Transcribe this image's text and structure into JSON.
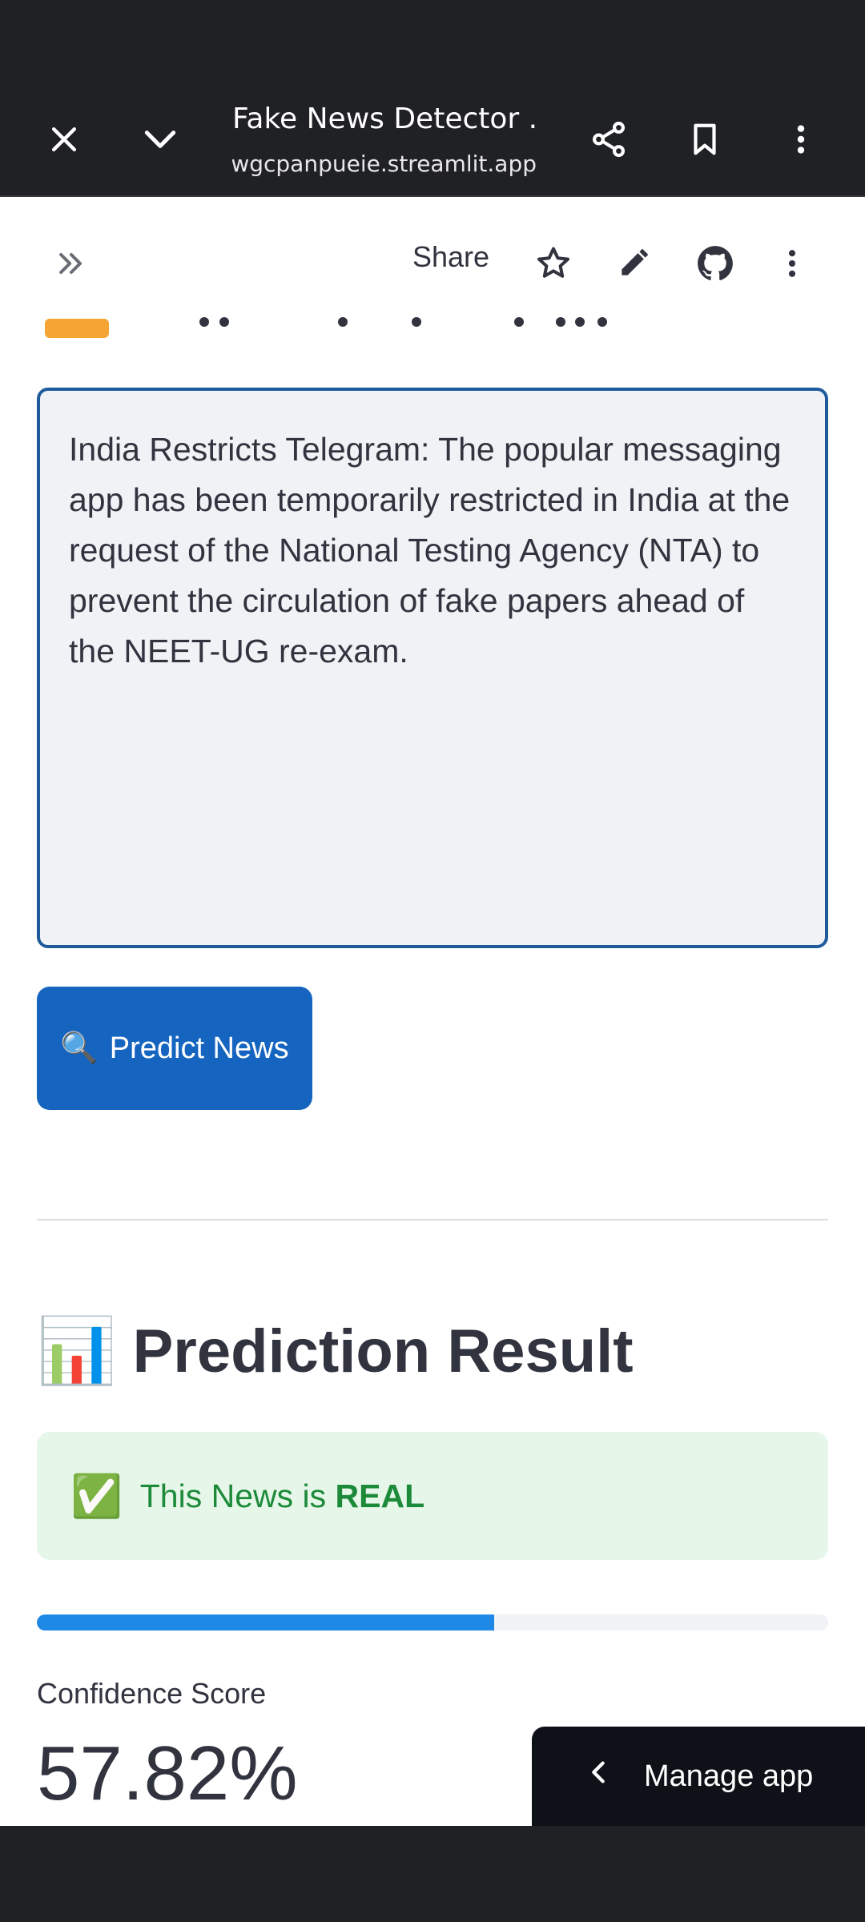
{
  "browser": {
    "title": "Fake News Detector ...",
    "url": "wgcpanpueie.streamlit.app",
    "icons": [
      "close-icon",
      "chevron-down-icon",
      "share-icon",
      "bookmark-icon",
      "more-vertical-icon"
    ]
  },
  "app_header": {
    "share_label": "Share",
    "icons": [
      "expand-sidebar-icon",
      "star-icon",
      "edit-icon",
      "github-icon",
      "more-vertical-icon"
    ]
  },
  "input": {
    "text": "India Restricts Telegram: The popular messaging app has been temporarily restricted in India at the request of the National Testing Agency (NTA) to prevent the circulation of fake papers ahead of the NEET-UG re-exam."
  },
  "predict_button": {
    "icon": "🔍",
    "label": "Predict News"
  },
  "result": {
    "heading_icon": "📊",
    "heading": "Prediction Result",
    "alert_icon": "✅",
    "alert_prefix": "This News is ",
    "alert_verdict": "REAL",
    "progress_percent": 57.82,
    "confidence_label": "Confidence Score",
    "confidence_value": "57.82%"
  },
  "manage_app": {
    "label": "Manage app"
  },
  "colors": {
    "accent": "#1565c0",
    "progress": "#1e88e5",
    "success_bg": "#e6f7ea",
    "success_text": "#1d8a3a",
    "browser_bar": "#202124"
  }
}
